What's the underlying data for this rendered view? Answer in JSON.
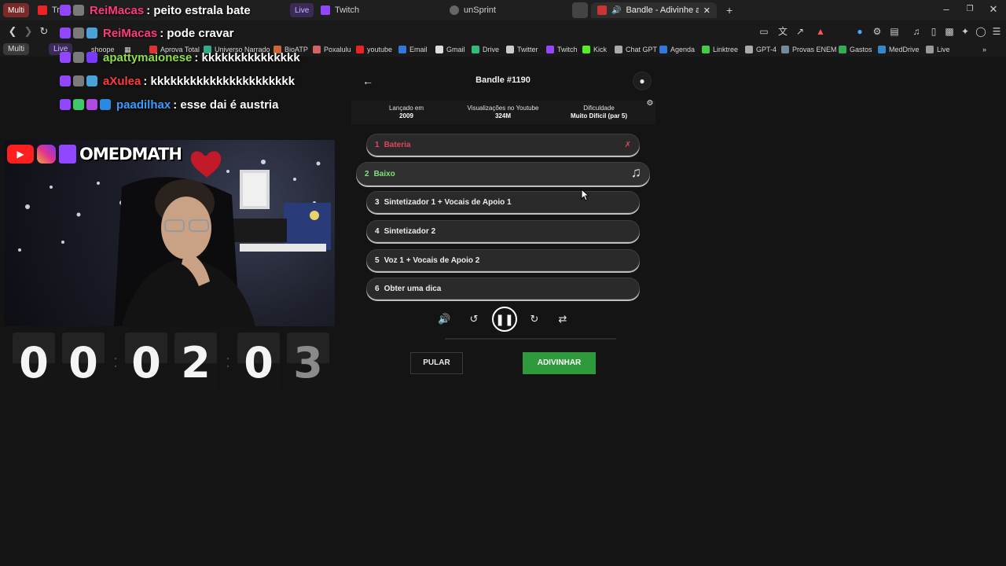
{
  "tabs": [
    {
      "label": "Multi",
      "type": "pill"
    },
    {
      "label": "Tra...",
      "type": "youtube"
    },
    {
      "label": "Live",
      "type": "pill"
    },
    {
      "label": "Twitch",
      "type": "twitch"
    },
    {
      "label": "unSprint",
      "type": "globe"
    },
    {
      "label": "Bandle - Adivinhe a música, u",
      "type": "bandle",
      "active": true
    }
  ],
  "addressbar": {
    "pills": [
      "Multi",
      "Live"
    ],
    "shortcut": "shoope"
  },
  "bookmarks": [
    {
      "label": "Aprova Total",
      "color": "#d33"
    },
    {
      "label": "Universo Narrado",
      "color": "#3a8"
    },
    {
      "label": "BioATP",
      "color": "#c63"
    },
    {
      "label": "Poxalulu",
      "color": "#c66"
    },
    {
      "label": "youtube",
      "color": "#e22"
    },
    {
      "label": "Email",
      "color": "#37d"
    },
    {
      "label": "Gmail",
      "color": "#ddd"
    },
    {
      "label": "Drive",
      "color": "#3b7"
    },
    {
      "label": "Twitter",
      "color": "#ccc"
    },
    {
      "label": "Twitch",
      "color": "#94f"
    },
    {
      "label": "Kick",
      "color": "#5e2"
    },
    {
      "label": "Chat GPT",
      "color": "#aaa"
    },
    {
      "label": "Agenda",
      "color": "#37d"
    },
    {
      "label": "Linktree",
      "color": "#4c4"
    },
    {
      "label": "GPT-4",
      "color": "#aaa"
    },
    {
      "label": "Provas ENEM",
      "color": "#789"
    },
    {
      "label": "Gastos",
      "color": "#3a5"
    },
    {
      "label": "MedDrive",
      "color": "#38c"
    },
    {
      "label": "Live",
      "color": "#999"
    }
  ],
  "chat": [
    {
      "user": "ReiMacas",
      "user_color": "#ff3a7a",
      "message": ": peito estrala bate"
    },
    {
      "user": "ReiMacas",
      "user_color": "#ff3a7a",
      "message": ": pode cravar"
    },
    {
      "user": "apattymaionese",
      "user_color": "#8fdc4c",
      "message": ": kkkkkkkkkkkkkkk"
    },
    {
      "user": "aXulea",
      "user_color": "#ff3a3a",
      "message": ": kkkkkkkkkkkkkkkkkkkkkk"
    },
    {
      "user": "paadilhax",
      "user_color": "#3a9cff",
      "message": ": esse dai é austria"
    }
  ],
  "webcam": {
    "channel": "OMEDMATH"
  },
  "timer": {
    "digits": [
      "0",
      "0",
      "0",
      "2",
      "0",
      "3"
    ]
  },
  "bandle": {
    "title": "Bandle #1190",
    "stats": [
      {
        "label": "Lançado em",
        "value": "2009"
      },
      {
        "label": "Visualizações no Youtube",
        "value": "324M"
      },
      {
        "label": "Dificuldade",
        "value": "Muito Difícil (par 5)"
      }
    ],
    "tracks": [
      {
        "num": "1",
        "label": "Bateria",
        "state": "wrong"
      },
      {
        "num": "2",
        "label": "Baixo",
        "state": "current"
      },
      {
        "num": "3",
        "label": "Sintetizador 1 + Vocais de Apoio 1",
        "state": "locked"
      },
      {
        "num": "4",
        "label": "Sintetizador 2",
        "state": "locked"
      },
      {
        "num": "5",
        "label": "Voz 1 + Vocais de Apoio 2",
        "state": "locked"
      },
      {
        "num": "6",
        "label": "Obter uma dica",
        "state": "locked"
      }
    ],
    "skip_label": "PULAR",
    "guess_label": "ADIVINHAR",
    "progress": 0.0
  }
}
